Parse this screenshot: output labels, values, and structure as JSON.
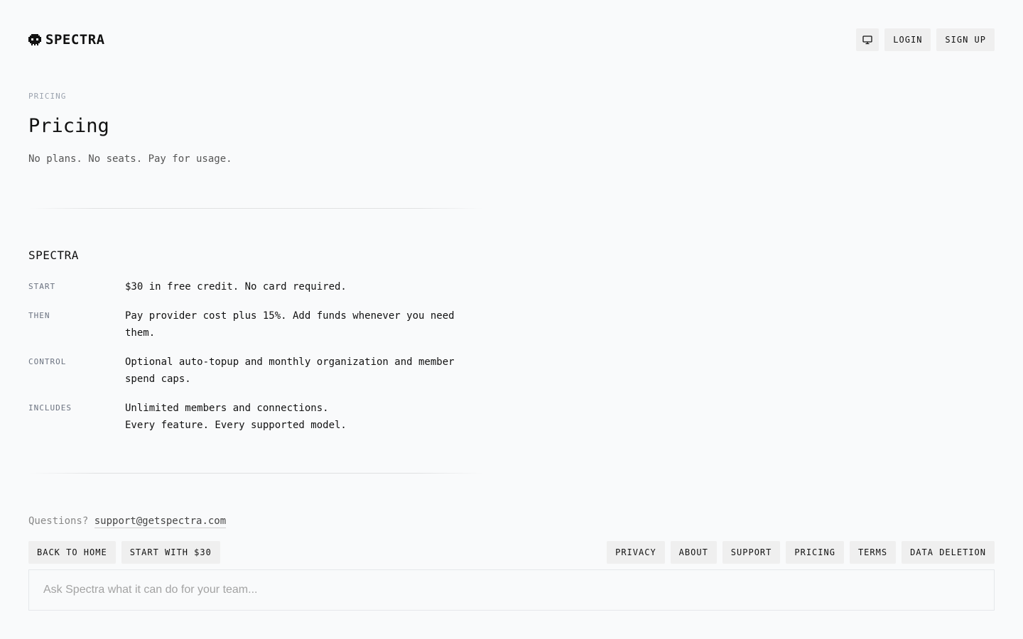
{
  "brand": {
    "name": "SPECTRA",
    "logo_icon": "alien-skull-icon"
  },
  "header": {
    "theme_icon": "monitor-icon",
    "login_label": "LOGIN",
    "signup_label": "SIGN UP"
  },
  "hero": {
    "eyebrow": "PRICING",
    "title": "Pricing",
    "subtitle": "No plans. No seats. Pay for usage."
  },
  "plan": {
    "name": "SPECTRA",
    "rows": [
      {
        "label": "START",
        "lines": [
          "$30 in free credit. No card required."
        ]
      },
      {
        "label": "THEN",
        "lines": [
          "Pay provider cost plus 15%. Add funds whenever you need",
          "them."
        ]
      },
      {
        "label": "CONTROL",
        "lines": [
          "Optional auto-topup and monthly organization and member",
          "spend caps."
        ]
      },
      {
        "label": "INCLUDES",
        "lines": [
          "Unlimited members and connections.",
          "Every feature. Every supported model."
        ]
      }
    ]
  },
  "footer": {
    "questions_label": "Questions?",
    "support_email": "support@getspectra.com",
    "back_home_label": "BACK TO HOME",
    "start_label": "START WITH $30",
    "links": {
      "privacy": "PRIVACY",
      "about": "ABOUT",
      "support": "SUPPORT",
      "pricing": "PRICING",
      "terms": "TERMS",
      "data_deletion": "DATA DELETION"
    }
  },
  "chat": {
    "placeholder": "Ask Spectra what it can do for your team..."
  }
}
